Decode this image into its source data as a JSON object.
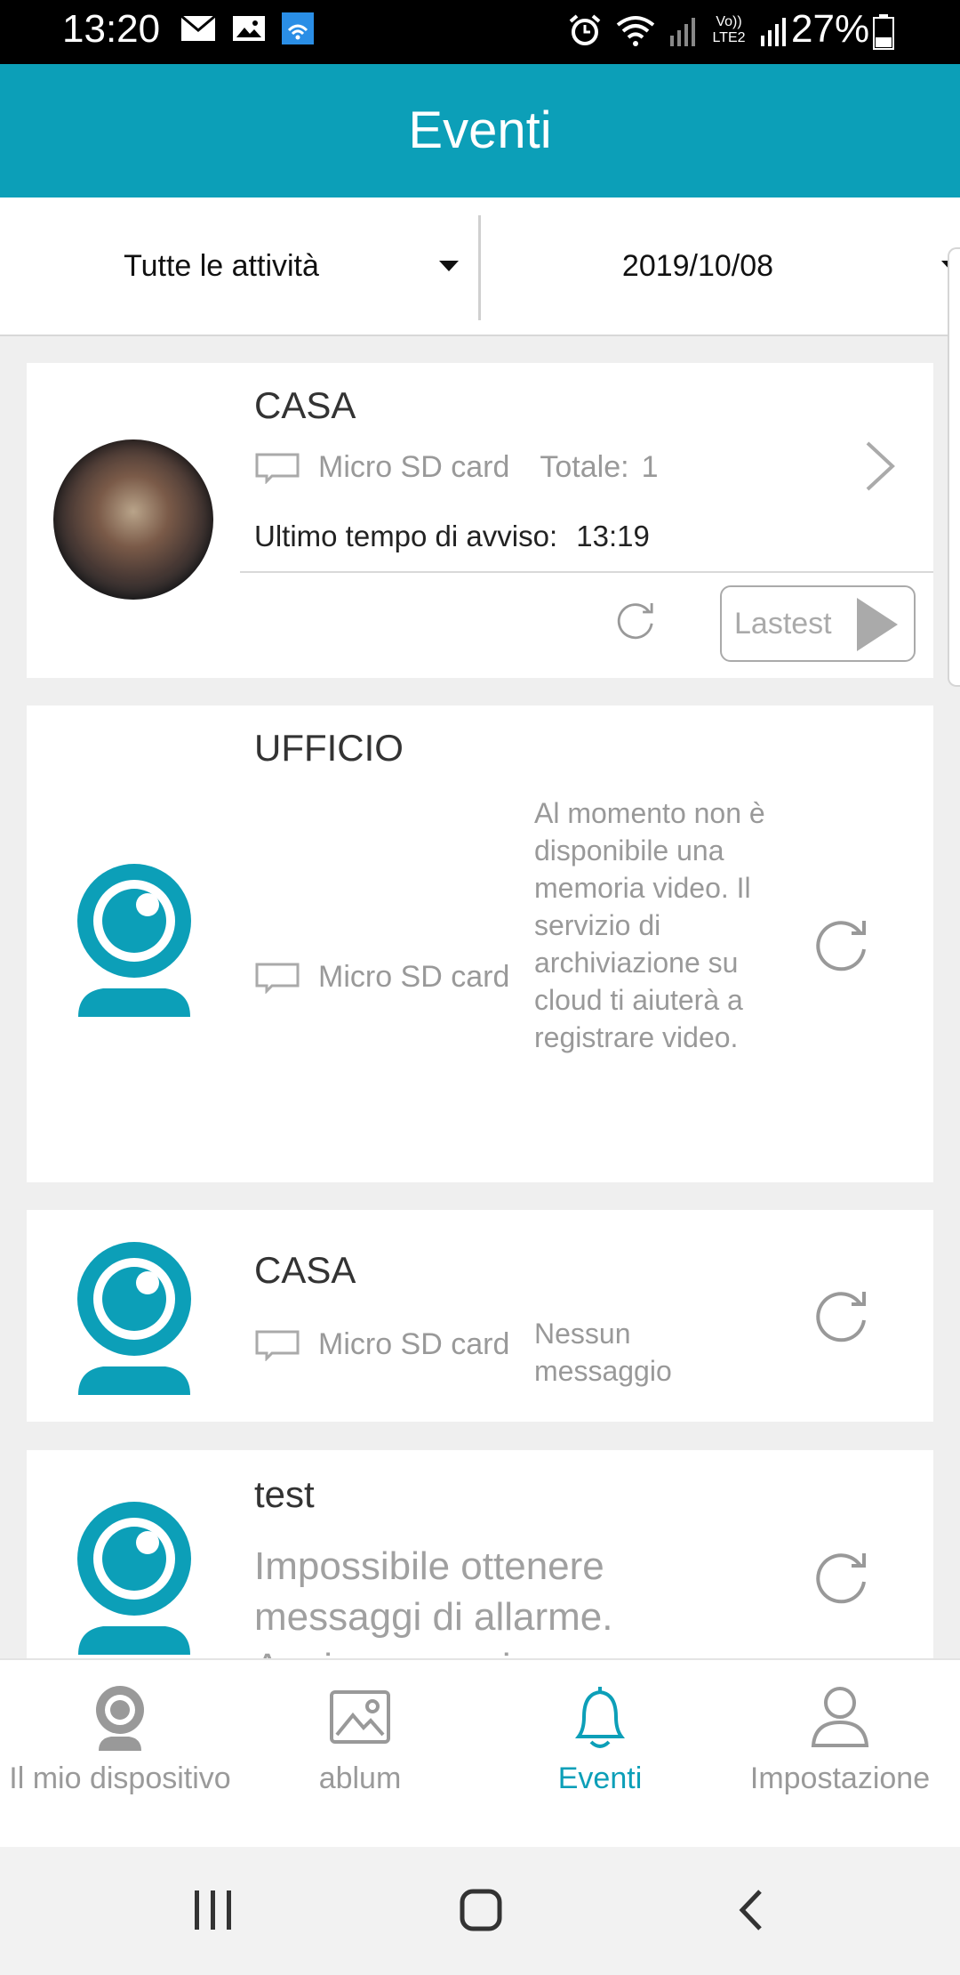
{
  "status_bar": {
    "time": "13:20",
    "battery": "27%",
    "network_label": "Vo)) LTE2"
  },
  "header": {
    "title": "Eventi"
  },
  "filters": {
    "activity": "Tutte le attività",
    "date": "2019/10/08"
  },
  "cards": [
    {
      "name": "CASA",
      "storage": "Micro SD card",
      "total_label": "Totale:",
      "total_value": "1",
      "last_alert_label": "Ultimo tempo di avviso:",
      "last_alert_time": "13:19",
      "latest_button": "Lastest"
    },
    {
      "name": "UFFICIO",
      "storage": "Micro SD card",
      "message": "Al momento non è disponibile una memoria video. Il servizio di archiviazione su cloud ti aiuterà a registrare video."
    },
    {
      "name": "CASA",
      "storage": "Micro SD card",
      "message": "Nessun messaggio"
    },
    {
      "name": "test",
      "message": "Impossibile ottenere messaggi di allarme. Aggiorna per riprovare"
    }
  ],
  "bottom_nav": [
    {
      "label": "Il mio dispositivo",
      "icon": "camera-icon"
    },
    {
      "label": "ablum",
      "icon": "image-icon"
    },
    {
      "label": "Eventi",
      "icon": "bell-icon",
      "active": true
    },
    {
      "label": "Impostazione",
      "icon": "person-icon"
    }
  ],
  "colors": {
    "accent": "#0c9fb8",
    "muted": "#999999"
  }
}
